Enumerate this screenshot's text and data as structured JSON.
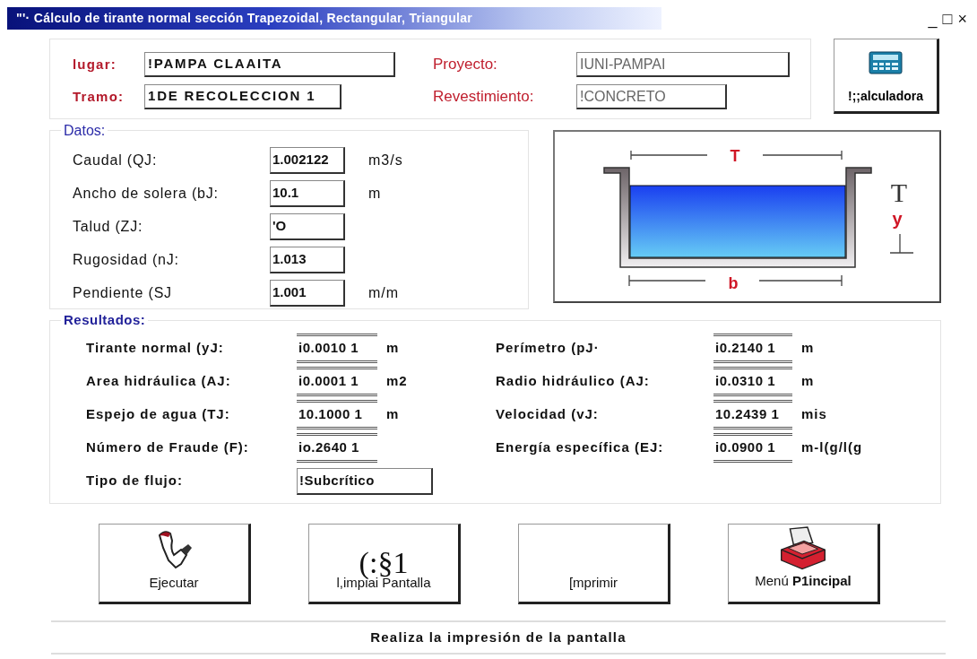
{
  "window": {
    "title": "\"'· Cálculo de tirante normal sección Trapezoidal, Rectangular, Triangular",
    "controls": [
      "_",
      "□",
      "×"
    ]
  },
  "header": {
    "fields": [
      {
        "label": "lugar:",
        "value": "!PAMPA CLAAITA",
        "kind": "bold"
      },
      {
        "label": "Proyecto:",
        "value": "IUNI-PAMPAI",
        "kind": "plain"
      },
      {
        "label": "Tramo:",
        "value": "1DE RECOLECCION 1",
        "kind": "bold"
      },
      {
        "label": "Revestimiento:",
        "value": "!CONCRETO",
        "kind": "plain"
      }
    ],
    "calculator_button": "!;;alculadora"
  },
  "datos": {
    "title": "Datos:",
    "rows": [
      {
        "label": "Caudal (QJ:",
        "value": "1.002122",
        "unit": "m3/s"
      },
      {
        "label": "Ancho de solera (bJ:",
        "value": "10.1",
        "unit": "m"
      },
      {
        "label": "Talud (ZJ:",
        "value": "'O"
      },
      {
        "label": "Rugosidad (nJ:",
        "value": "1.013"
      },
      {
        "label": "Pendiente (SJ",
        "value": "1.001",
        "unit": "m/m"
      }
    ]
  },
  "diagram": {
    "top": "T",
    "side_top": "T",
    "side": "y",
    "bottom": "b"
  },
  "resultados": {
    "title": "Resultados:",
    "left": [
      {
        "label": "Tirante normal (yJ:",
        "value": "i0.0010 1",
        "unit": "m"
      },
      {
        "label": "Area hidráulica (AJ:",
        "value": "i0.0001 1",
        "unit": "m2"
      },
      {
        "label": "Espejo de agua (TJ:",
        "value": "10.1000 1",
        "unit": "m"
      },
      {
        "label": "Número de Fraude (F):",
        "value": "io.2640 1"
      },
      {
        "label": "Tipo de flujo:",
        "value": "!Subcrítico",
        "kind": "box"
      }
    ],
    "right": [
      {
        "label": "Perímetro (pJ·",
        "value": "i0.2140 1",
        "unit": "m"
      },
      {
        "label": "Radio hidráulico (AJ:",
        "value": "i0.0310 1",
        "unit": "m"
      },
      {
        "label": "Velocidad (vJ:",
        "value": "10.2439 1",
        "unit": "mis"
      },
      {
        "label": "Energía específica (EJ:",
        "value": "i0.0900 1",
        "unit": "m-l(g/l(g"
      }
    ]
  },
  "buttons": [
    {
      "kind": "execute",
      "label": "Ejecutar"
    },
    {
      "kind": "clear",
      "glyph": "(:§1",
      "label": "l,impiai Pantalla"
    },
    {
      "kind": "print",
      "label": "[mprimir"
    },
    {
      "kind": "menu",
      "label": "Menú **P1incipal**"
    }
  ],
  "status_bar": "Realiza la impresión de la pantalla"
}
